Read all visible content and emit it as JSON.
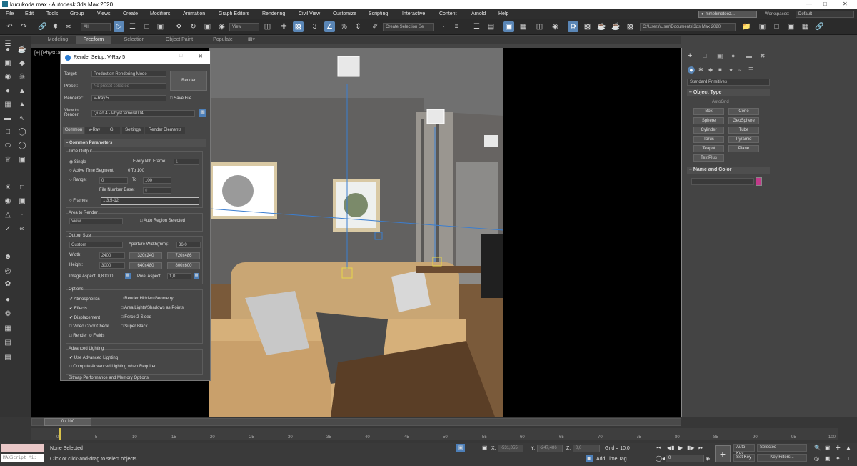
{
  "window": {
    "title": "kucukoda.max - Autodesk 3ds Max 2020"
  },
  "menus": [
    "File",
    "Edit",
    "Tools",
    "Group",
    "Views",
    "Create",
    "Modifiers",
    "Animation",
    "Graph Editors",
    "Rendering",
    "Civil View",
    "Customize",
    "Scripting",
    "Interactive",
    "Content",
    "Arnold",
    "Help"
  ],
  "account": {
    "user": "mmehmetooz..."
  },
  "workspaces": {
    "label": "Workspaces:",
    "value": "Default"
  },
  "toolbar": {
    "selection_filter": "All",
    "ref_coord": "View",
    "selection_set_placeholder": "Create Selection Se",
    "project_path": "C:\\Users\\User\\Documents\\3ds Max 2020",
    "snap_value": "3"
  },
  "ribbon": {
    "tabs": [
      "Modeling",
      "Freeform",
      "Selection",
      "Object Paint",
      "Populate"
    ],
    "active": "Freeform"
  },
  "viewport": {
    "label": "[+] [PhysCa..."
  },
  "render_setup": {
    "title": "Render Setup: V-Ray 5",
    "target_label": "Target:",
    "target_value": "Production Rendering Mode",
    "preset_label": "Preset:",
    "preset_value": "No preset selected",
    "renderer_label": "Renderer:",
    "renderer_value": "V-Ray 5",
    "save_file": "Save File",
    "view_label": "View to Render:",
    "view_value": "Quad 4 - PhysCamera004",
    "render_button": "Render",
    "tabs": [
      "Common",
      "V-Ray",
      "GI",
      "Settings",
      "Render Elements"
    ],
    "rollout": "Common Parameters",
    "time_output": "Time Output",
    "single": "Single",
    "every_nth": "Every Nth Frame:",
    "every_nth_value": "1",
    "active_segment": "Active Time Segment:",
    "active_segment_value": "0 To 100",
    "range": "Range:",
    "range_from": "0",
    "range_to_label": "To",
    "range_to": "100",
    "file_number_base": "File Number Base:",
    "file_number_base_value": "0",
    "frames": "Frames",
    "frames_value": "1,3,5-12",
    "area_to_render": "Area to Render",
    "area_value": "View",
    "auto_region": "Auto Region Selected",
    "output_size": "Output Size",
    "output_size_value": "Custom",
    "aperture_label": "Aperture Width(mm):",
    "aperture_value": "36,0",
    "width_label": "Width:",
    "width_value": "2400",
    "height_label": "Height:",
    "height_value": "3000",
    "presets": [
      "320x240",
      "720x486",
      "640x480",
      "800x600"
    ],
    "image_aspect": "Image Aspect: 0,80000",
    "pixel_aspect_label": "Pixel Aspect:",
    "pixel_aspect_value": "1,0",
    "options": "Options",
    "opt_left": [
      {
        "label": "Atmospherics",
        "checked": true
      },
      {
        "label": "Effects",
        "checked": true
      },
      {
        "label": "Displacement",
        "checked": true
      },
      {
        "label": "Video Color Check",
        "checked": false
      },
      {
        "label": "Render to Fields",
        "checked": false
      }
    ],
    "opt_right": [
      {
        "label": "Render Hidden Geometry",
        "checked": false
      },
      {
        "label": "Area Lights/Shadows as Points",
        "checked": false
      },
      {
        "label": "Force 2-Sided",
        "checked": false
      },
      {
        "label": "Super Black",
        "checked": false
      }
    ],
    "advanced_lighting": "Advanced Lighting",
    "use_adv_lighting": "Use Advanced Lighting",
    "compute_adv_lighting": "Compute Advanced Lighting when Required",
    "bitmap_perf": "Bitmap Performance and Memory Options"
  },
  "command_panel": {
    "category": "Standard Primitives",
    "object_type": "Object Type",
    "autogrid": "AutoGrid",
    "buttons": [
      "Box",
      "Cone",
      "Sphere",
      "GeoSphere",
      "Cylinder",
      "Tube",
      "Torus",
      "Pyramid",
      "Teapot",
      "Plane",
      "TextPlus"
    ],
    "name_and_color": "Name and Color",
    "color": "#c23a8a"
  },
  "timeline": {
    "frame": "0 / 100",
    "ticks": [
      "0",
      "5",
      "10",
      "15",
      "20",
      "25",
      "30",
      "35",
      "40",
      "45",
      "50",
      "55",
      "60",
      "65",
      "70",
      "75",
      "80",
      "85",
      "90",
      "95",
      "100"
    ]
  },
  "status": {
    "maxscript": "MAXScript Mi:",
    "none_selected": "None Selected",
    "hint": "Click or click-and-drag to select objects",
    "x_label": "X:",
    "x_value": "-531,055",
    "y_label": "Y:",
    "y_value": "-247,486",
    "z_label": "Z:",
    "z_value": "0,0",
    "grid": "Grid = 10,0",
    "add_time_tag": "Add Time Tag",
    "auto_key": "Auto Key",
    "set_key": "Set Key",
    "selected": "Selected",
    "key_filters": "Key Filters...",
    "frame_value": "0"
  }
}
